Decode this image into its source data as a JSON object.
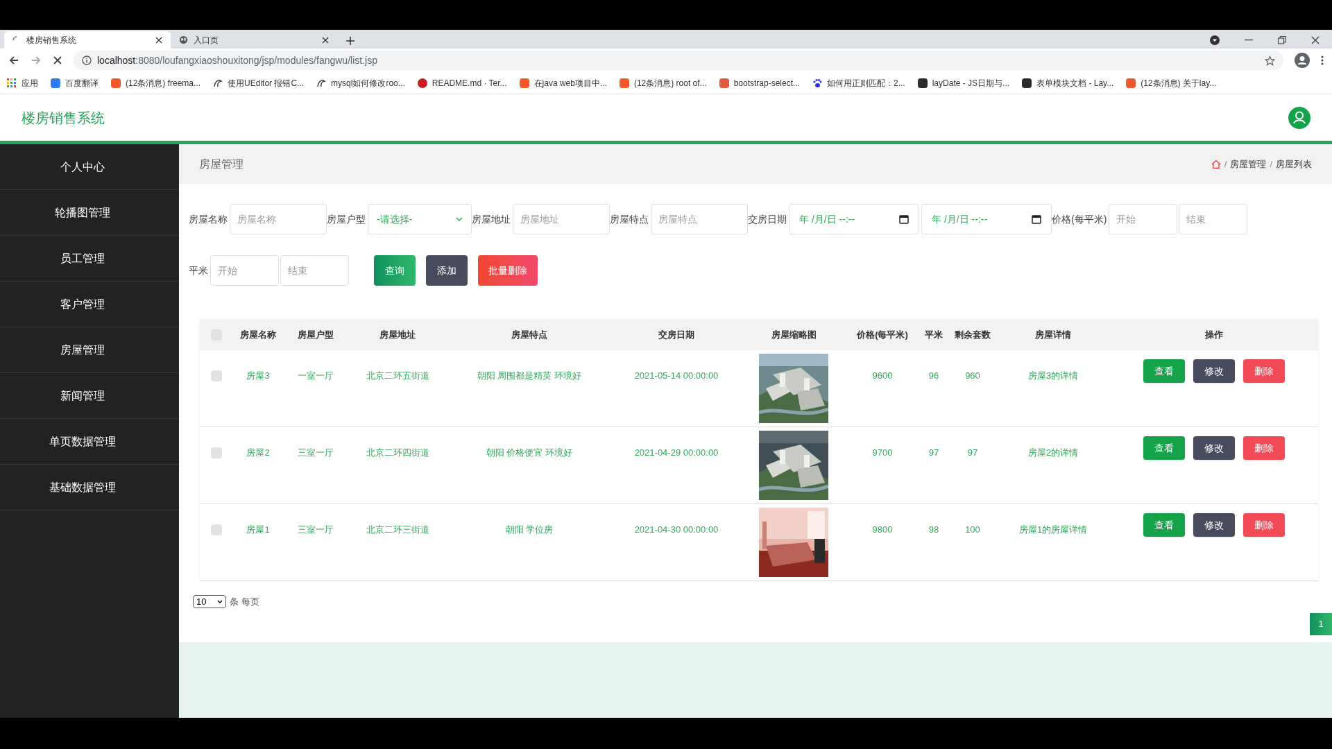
{
  "browser": {
    "tabs": [
      {
        "title": "楼房销售系统",
        "selected": true,
        "loading": true
      },
      {
        "title": "入口页",
        "selected": false,
        "loading": false
      }
    ],
    "url_host": "localhost",
    "url_rest": ":8080/loufangxiaoshouxitong/jsp/modules/fangwu/list.jsp",
    "bookmarks": [
      {
        "label": "应用",
        "kind": "apps"
      },
      {
        "label": "百度翻译",
        "kind": "blue"
      },
      {
        "label": "(12条消息) freema...",
        "kind": "csdn"
      },
      {
        "label": "使用UEditor 报错C...",
        "kind": "swirl"
      },
      {
        "label": "mysql如何修改roo...",
        "kind": "swirl"
      },
      {
        "label": "README.md · Ter...",
        "kind": "gitee"
      },
      {
        "label": "在java web项目中...",
        "kind": "csdn"
      },
      {
        "label": "(12条消息) root of...",
        "kind": "csdn"
      },
      {
        "label": "bootstrap-select...",
        "kind": "jian"
      },
      {
        "label": "如何用正则匹配：2...",
        "kind": "paw"
      },
      {
        "label": "layDate - JS日期与...",
        "kind": "layui"
      },
      {
        "label": "表单模块文档 - Lay...",
        "kind": "layui"
      },
      {
        "label": "(12条消息) 关于lay...",
        "kind": "csdn"
      }
    ]
  },
  "header": {
    "title": "楼房销售系统"
  },
  "sidebar": {
    "items": [
      {
        "label": "个人中心"
      },
      {
        "label": "轮播图管理"
      },
      {
        "label": "员工管理"
      },
      {
        "label": "客户管理"
      },
      {
        "label": "房屋管理"
      },
      {
        "label": "新闻管理"
      },
      {
        "label": "单页数据管理"
      },
      {
        "label": "基础数据管理"
      }
    ]
  },
  "content": {
    "title": "房屋管理",
    "breadcrumb_separator": "/",
    "breadcrumbs": [
      "房屋管理",
      "房屋列表"
    ]
  },
  "filter_rows": [
    [
      {
        "label": "房屋名称",
        "kind": "text",
        "placeholder": "房屋名称"
      },
      {
        "label": "房屋户型",
        "kind": "select",
        "value": "-请选择-"
      },
      {
        "label": "房屋地址",
        "kind": "text",
        "placeholder": "房屋地址"
      },
      {
        "label": "房屋特点",
        "kind": "text",
        "placeholder": "房屋特点"
      },
      {
        "label": "交房日期",
        "kind": "date_range",
        "values": [
          "年 /月/日 --:--",
          "年 /月/日 --:--"
        ]
      },
      {
        "label": "价格(每平米)",
        "kind": "range",
        "placeholders": [
          "开始",
          "结束"
        ]
      }
    ],
    [
      {
        "label": "平米",
        "kind": "range",
        "placeholders": [
          "开始",
          "结束"
        ]
      }
    ]
  ],
  "buttons": [
    {
      "label": "查询",
      "kind": "search"
    },
    {
      "label": "添加",
      "kind": "add"
    },
    {
      "label": "批量删除",
      "kind": "batch_delete"
    }
  ],
  "table": {
    "header_checked": false,
    "columns": [
      "房屋名称",
      "房屋户型",
      "房屋地址",
      "房屋特点",
      "交房日期",
      "房屋缩略图",
      "价格(每平米)",
      "平米",
      "剩余套数",
      "房屋详情",
      "操作"
    ],
    "rows": [
      {
        "checked": false,
        "name": "房屋3",
        "type": "一室一厅",
        "address": "北京二环五街道",
        "features": "朝阳 周围都是精英 环境好",
        "date": "2021-05-14 00:00:00",
        "price": "9600",
        "area": "96",
        "remaining": "960",
        "details": "房屋3的详情",
        "actions": [
          {
            "label": "查看",
            "kind": "view"
          },
          {
            "label": "修改",
            "kind": "edit"
          },
          {
            "label": "删除",
            "kind": "delete"
          }
        ]
      },
      {
        "checked": false,
        "name": "房屋2",
        "type": "三室一厅",
        "address": "北京二环四街道",
        "features": "朝阳 价格便宜 环境好",
        "date": "2021-04-29 00:00:00",
        "price": "9700",
        "area": "97",
        "remaining": "97",
        "details": "房屋2的详情",
        "actions": [
          {
            "label": "查看",
            "kind": "view"
          },
          {
            "label": "修改",
            "kind": "edit"
          },
          {
            "label": "删除",
            "kind": "delete"
          }
        ]
      },
      {
        "checked": false,
        "name": "房屋1",
        "type": "三室一厅",
        "address": "北京二环三街道",
        "features": "朝阳 学位房",
        "date": "2021-04-30 00:00:00",
        "price": "9800",
        "area": "98",
        "remaining": "100",
        "details": "房屋1的房屋详情",
        "actions": [
          {
            "label": "查看",
            "kind": "view"
          },
          {
            "label": "修改",
            "kind": "edit"
          },
          {
            "label": "删除",
            "kind": "delete"
          }
        ]
      }
    ]
  },
  "pagination": {
    "page_size": "10",
    "per_page_label": "条 每页",
    "pages": [
      {
        "label": "1",
        "selected": true
      }
    ]
  }
}
